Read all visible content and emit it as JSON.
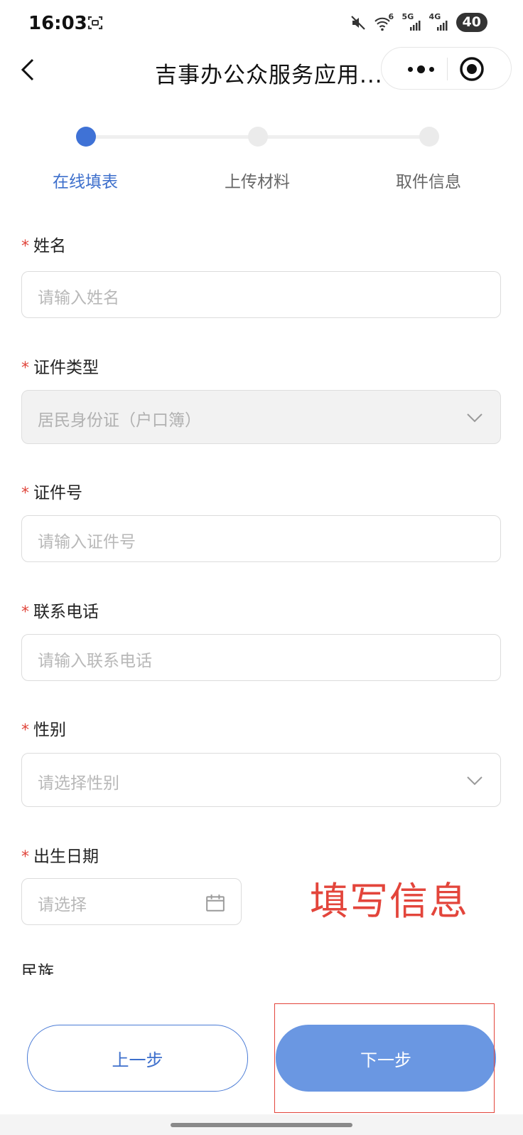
{
  "status_bar": {
    "time": "16:03",
    "wifi_label": "6",
    "sim1_label": "5G",
    "sim2_label": "4G",
    "battery": "40"
  },
  "nav": {
    "title": "吉事办公众服务应用..."
  },
  "stepper": {
    "steps": [
      "在线填表",
      "上传材料",
      "取件信息"
    ],
    "active_index": 0
  },
  "form": {
    "required_mark": "*",
    "fields": [
      {
        "label": "姓名",
        "placeholder": "请输入姓名",
        "type": "text"
      },
      {
        "label": "证件类型",
        "value": "居民身份证（户口簿）",
        "type": "select",
        "disabled": true
      },
      {
        "label": "证件号",
        "placeholder": "请输入证件号",
        "type": "text"
      },
      {
        "label": "联系电话",
        "placeholder": "请输入联系电话",
        "type": "text"
      },
      {
        "label": "性别",
        "placeholder": "请选择性别",
        "type": "select"
      },
      {
        "label": "出生日期",
        "placeholder": "请选择",
        "type": "date"
      }
    ],
    "next_label_partial": "民族"
  },
  "annotation": {
    "hint": "填写信息",
    "color": "#e3453b"
  },
  "buttons": {
    "prev": "上一步",
    "next": "下一步"
  },
  "colors": {
    "primary": "#3f72d6",
    "next_button": "#6a97e2"
  }
}
